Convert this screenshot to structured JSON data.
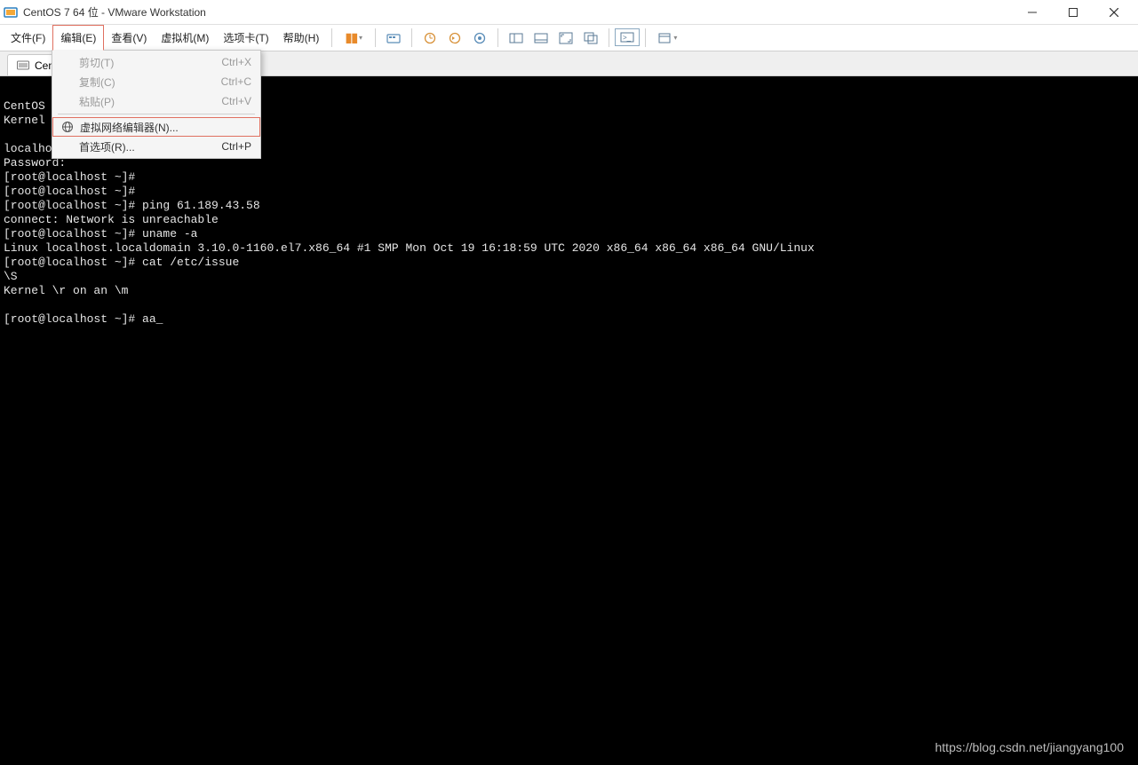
{
  "window": {
    "title": "CentOS 7 64 位 - VMware Workstation"
  },
  "menubar": {
    "file": "文件(F)",
    "edit": "编辑(E)",
    "view": "查看(V)",
    "vm": "虚拟机(M)",
    "tabs": "选项卡(T)",
    "help": "帮助(H)"
  },
  "edit_menu": {
    "cut": {
      "label": "剪切(T)",
      "shortcut": "Ctrl+X"
    },
    "copy": {
      "label": "复制(C)",
      "shortcut": "Ctrl+C"
    },
    "paste": {
      "label": "粘贴(P)",
      "shortcut": "Ctrl+V"
    },
    "vne": {
      "label": "虚拟网络编辑器(N)...",
      "shortcut": ""
    },
    "prefs": {
      "label": "首选项(R)...",
      "shortcut": "Ctrl+P"
    }
  },
  "tab": {
    "label": "Cent"
  },
  "terminal": {
    "lines": [
      "",
      "CentOS ",
      "Kernel                          86_64",
      "",
      "localho",
      "Password:",
      "[root@localhost ~]#",
      "[root@localhost ~]#",
      "[root@localhost ~]# ping 61.189.43.58",
      "connect: Network is unreachable",
      "[root@localhost ~]# uname -a",
      "Linux localhost.localdomain 3.10.0-1160.el7.x86_64 #1 SMP Mon Oct 19 16:18:59 UTC 2020 x86_64 x86_64 x86_64 GNU/Linux",
      "[root@localhost ~]# cat /etc/issue",
      "\\S",
      "Kernel \\r on an \\m",
      "",
      "[root@localhost ~]# aa_"
    ]
  },
  "watermark": "https://blog.csdn.net/jiangyang100"
}
